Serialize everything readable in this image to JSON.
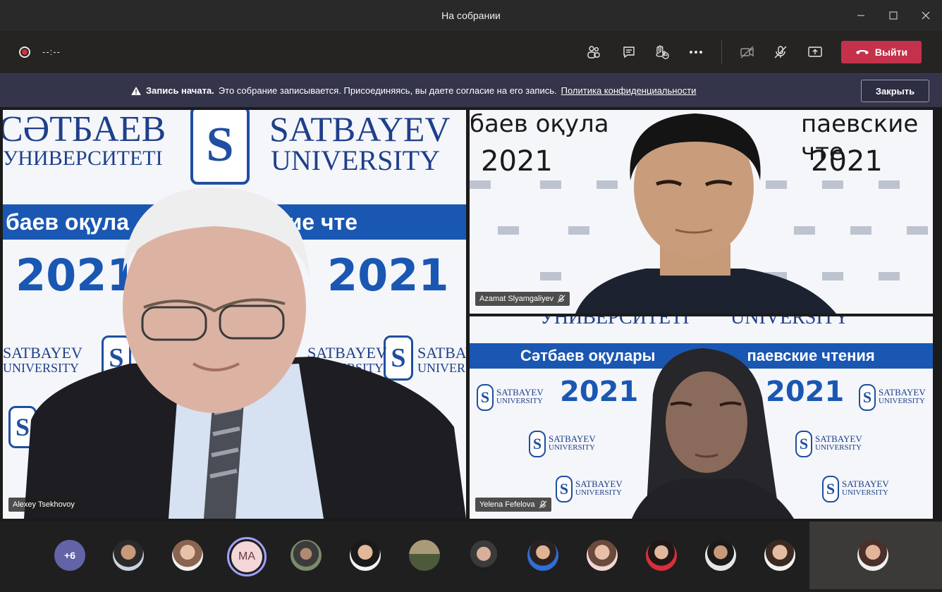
{
  "window": {
    "title": "На собрании"
  },
  "toolbar": {
    "timer": "--:--",
    "leave_label": "Выйти"
  },
  "banner": {
    "bold": "Запись начата.",
    "text": "Это собрание записывается. Присоединяясь, вы даете согласие на его запись.",
    "link": "Политика конфиденциальности",
    "close_label": "Закрыть"
  },
  "backdrop": {
    "kz_top": "СӘТБАЕВ",
    "kz_sub": "УНИВЕРСИТЕТІ",
    "en_top": "SATBAYEV",
    "en_sub": "UNIVERSITY",
    "band_kz_partial": "баев оқула",
    "band_ru_partial": "паевские чте",
    "band_kz_full": "Сәтбаев оқулары",
    "band_ru_full": "паевские чтения",
    "year": "2021",
    "logo_letter": "S"
  },
  "participants": {
    "main": {
      "name": "Alexey Tsekhovoy"
    },
    "top_right": {
      "name": "Azamat Slyamgaliyev"
    },
    "bottom_right": {
      "name": "Yelena Fefelova"
    }
  },
  "strip": {
    "more_count": "+6",
    "active_initials": "MA"
  },
  "colors": {
    "accent": "#6264a7",
    "leave": "#c4314b",
    "brand_blue": "#1a57b3",
    "recording": "#d13438"
  }
}
